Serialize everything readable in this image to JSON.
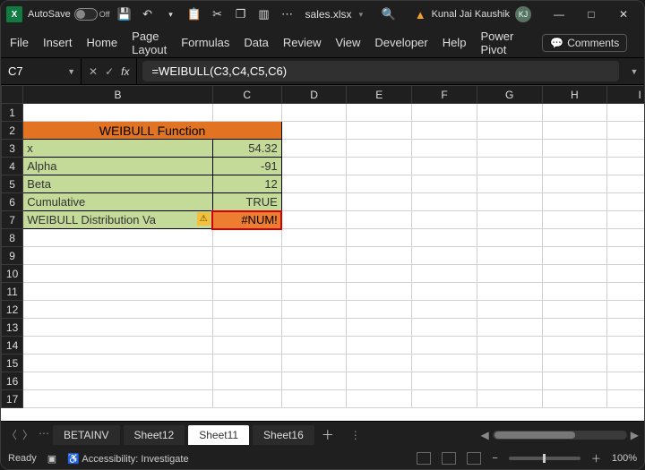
{
  "titlebar": {
    "autosave_label": "AutoSave",
    "autosave_state": "Off",
    "file_name": "sales.xlsx",
    "search_icon": "🔍",
    "user_name": "Kunal Jai Kaushik",
    "user_initials": "KJ"
  },
  "ribbon": {
    "items": [
      "File",
      "Insert",
      "Home",
      "Page Layout",
      "Formulas",
      "Data",
      "Review",
      "View",
      "Developer",
      "Help",
      "Power Pivot"
    ],
    "comments_label": "Comments"
  },
  "fx": {
    "namebox": "C7",
    "formula": "=WEIBULL(C3,C4,C5,C6)"
  },
  "columns": [
    "B",
    "C",
    "D",
    "E",
    "F",
    "G",
    "H",
    "I"
  ],
  "rows_visible": 17,
  "sheet": {
    "header_title": "WEIBULL Function",
    "rows": [
      {
        "label": "x",
        "value": "54.32"
      },
      {
        "label": "Alpha",
        "value": "-91"
      },
      {
        "label": "Beta",
        "value": "12"
      },
      {
        "label": "Cumulative",
        "value": "TRUE"
      },
      {
        "label": "WEIBULL Distribution Va",
        "value": "#NUM!"
      }
    ]
  },
  "tabs": {
    "items": [
      "BETAINV",
      "Sheet12",
      "Sheet11",
      "Sheet16"
    ],
    "active": "Sheet11"
  },
  "status": {
    "ready": "Ready",
    "accessibility": "Accessibility: Investigate",
    "zoom": "100%"
  }
}
